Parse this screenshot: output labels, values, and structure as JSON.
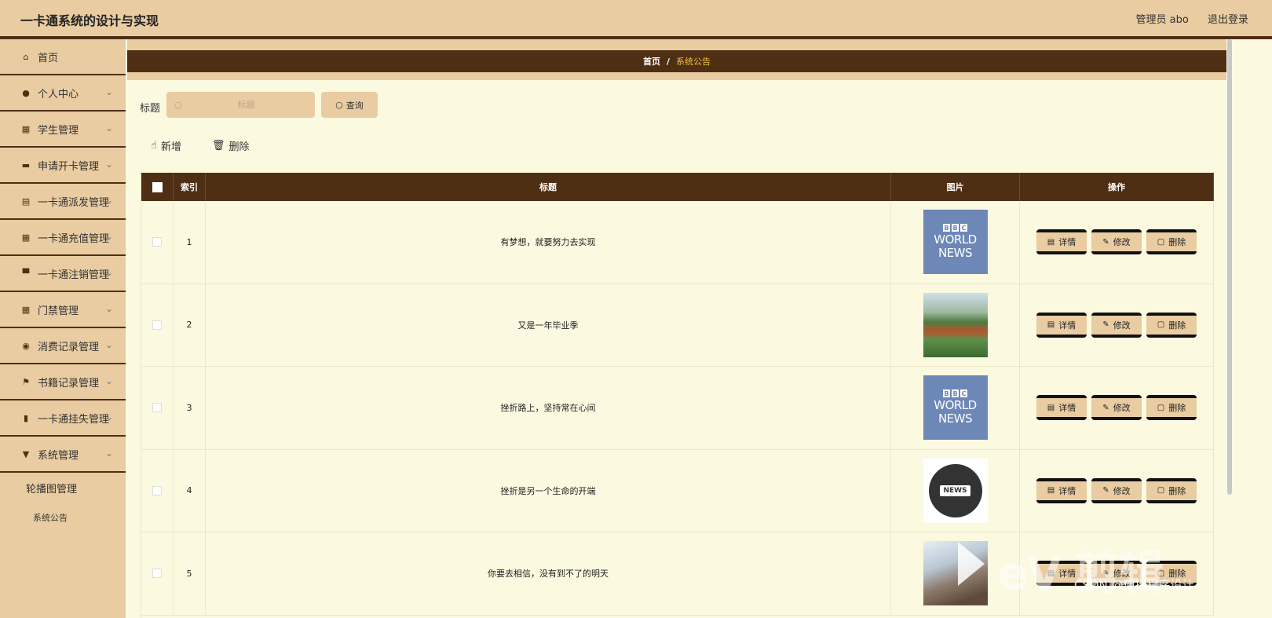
{
  "app": {
    "title": "一卡通系统的设计与实现",
    "user": "管理员 abo",
    "logout": "退出登录"
  },
  "sidebar": {
    "items": [
      {
        "label": "首页",
        "icon": "home-icon"
      },
      {
        "label": "个人中心",
        "icon": "user-icon"
      },
      {
        "label": "学生管理",
        "icon": "grid-icon"
      },
      {
        "label": "申请开卡管理",
        "icon": "card-icon"
      },
      {
        "label": "一卡通派发管理",
        "icon": "chart-icon"
      },
      {
        "label": "一卡通充值管理",
        "icon": "grid-icon"
      },
      {
        "label": "一卡通注销管理",
        "icon": "monitor-icon"
      },
      {
        "label": "门禁管理",
        "icon": "grid-icon"
      },
      {
        "label": "消费记录管理",
        "icon": "pin-icon"
      },
      {
        "label": "书籍记录管理",
        "icon": "flag-icon"
      },
      {
        "label": "一卡通挂失管理",
        "icon": "bar-chart-icon"
      },
      {
        "label": "系统管理",
        "icon": "sign-icon"
      }
    ],
    "subitems": [
      "轮播图管理",
      "系统公告"
    ]
  },
  "breadcrumb": {
    "home": "首页",
    "sep": "/",
    "current": "系统公告"
  },
  "search": {
    "label": "标题",
    "placeholder": "标题",
    "button": "查询"
  },
  "actions": {
    "add": "新增",
    "delete": "删除"
  },
  "table": {
    "headers": {
      "index": "索引",
      "title": "标题",
      "image": "图片",
      "ops": "操作"
    },
    "rows": [
      {
        "index": "1",
        "title": "有梦想，就要努力去实现",
        "image": "bbc-world-news"
      },
      {
        "index": "2",
        "title": "又是一年毕业季",
        "image": "campus-field"
      },
      {
        "index": "3",
        "title": "挫折路上，坚持常在心间",
        "image": "bbc-world-news"
      },
      {
        "index": "4",
        "title": "挫折是另一个生命的开端",
        "image": "news-globe"
      },
      {
        "index": "5",
        "title": "你要去相信，没有到不了的明天",
        "image": "building"
      }
    ],
    "op_labels": {
      "detail": "详情",
      "edit": "修改",
      "delete": "删除"
    }
  },
  "images": {
    "bbc_letters": [
      "B",
      "B",
      "C"
    ],
    "bbc_line1": "WORLD",
    "bbc_line2": "NEWS",
    "news_badge": "NEWS"
  },
  "watermark": {
    "logo": "eV 剪辑",
    "text": "CSDN @便捷程序设计"
  },
  "colors": {
    "accent": "#e9cca1",
    "dark": "#4f2f14",
    "page_bg": "#fbf9e0",
    "breadcrumb_current": "#f0c040"
  }
}
